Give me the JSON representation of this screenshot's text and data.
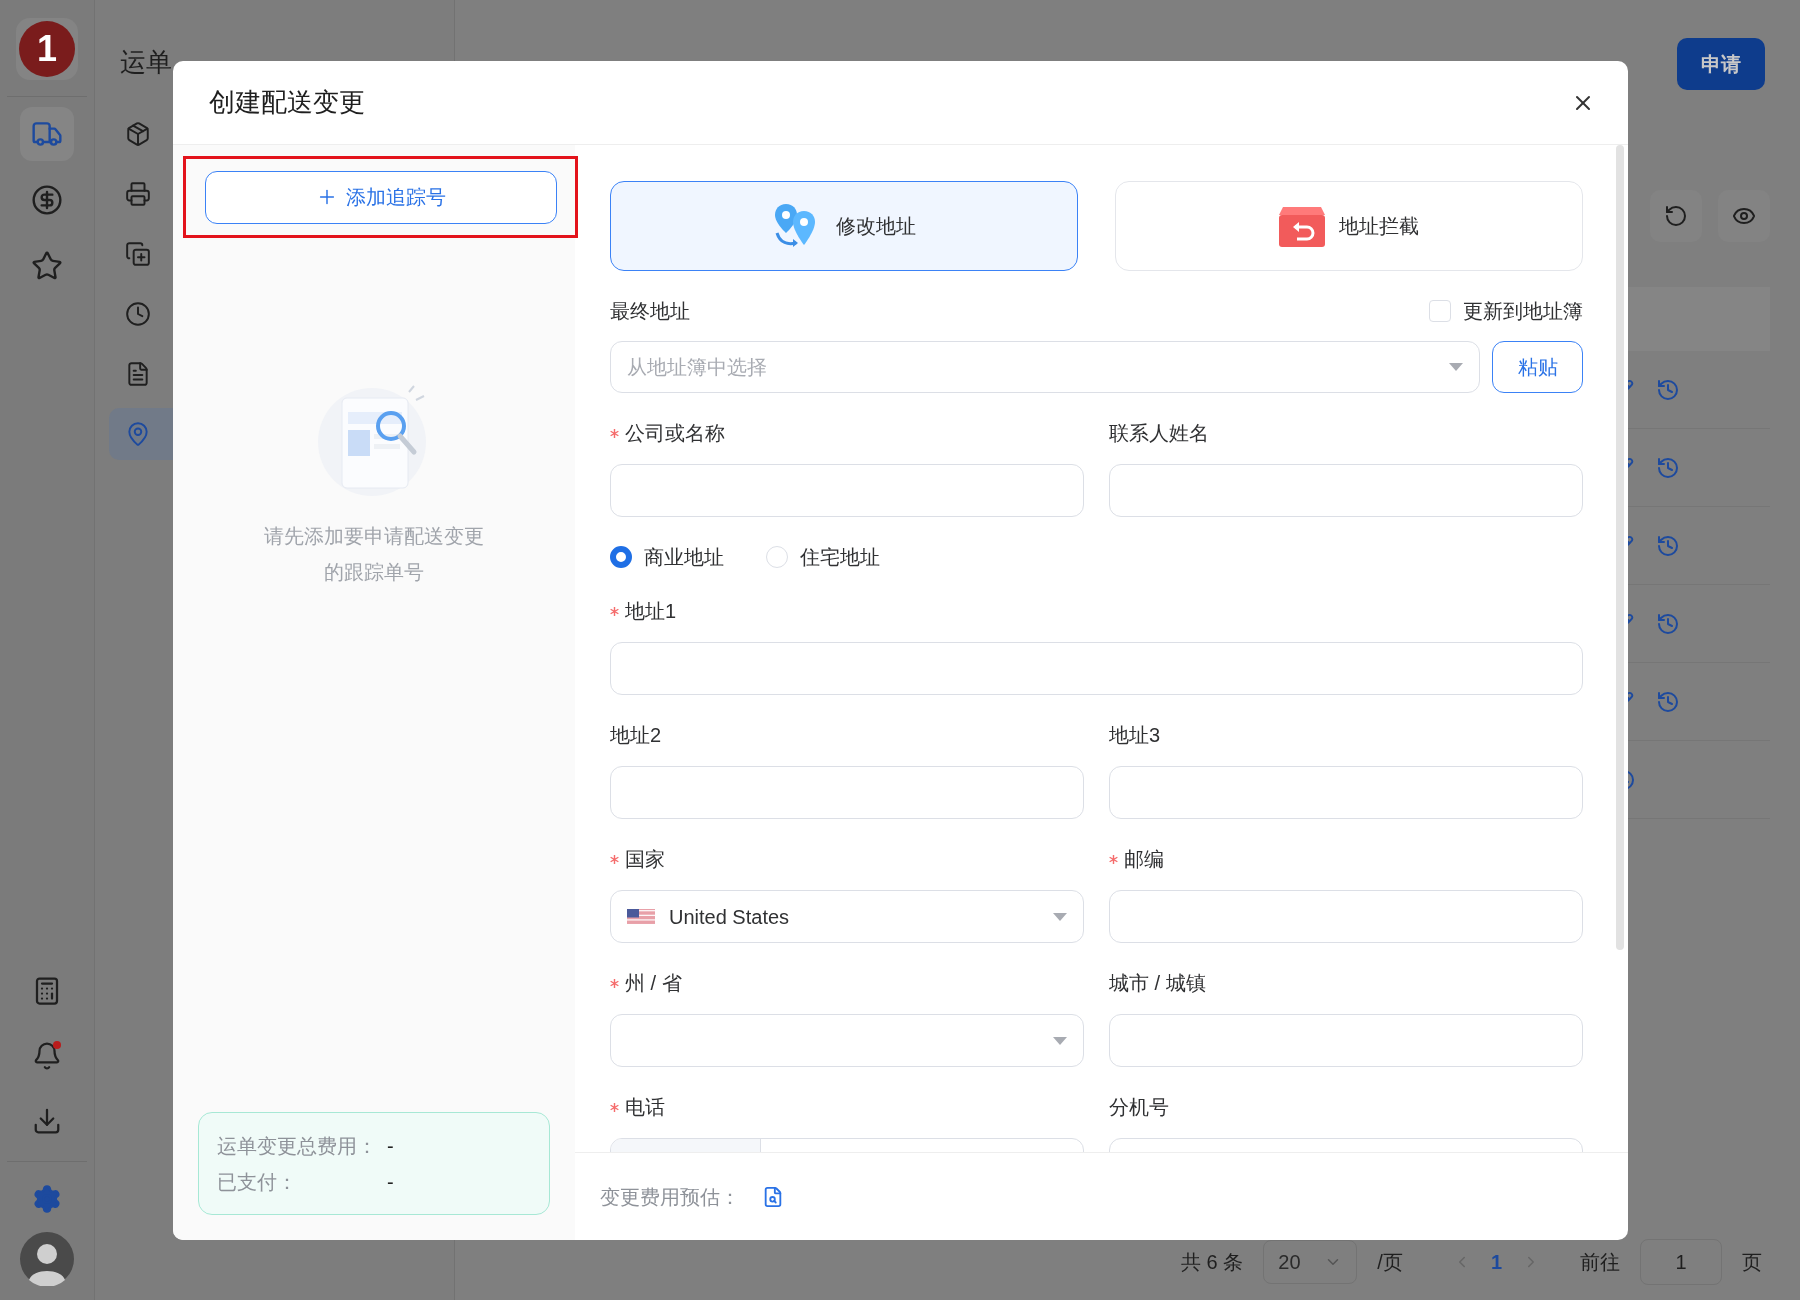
{
  "rail": {
    "logo_text": "1",
    "top_items": [
      {
        "selected": true
      },
      {
        "selected": false
      },
      {
        "selected": false
      }
    ],
    "bell_unread": true
  },
  "nav": {
    "title": "运单",
    "items": [
      {
        "selected": false
      },
      {
        "selected": false
      },
      {
        "selected": false
      },
      {
        "selected": false
      },
      {
        "selected": false
      },
      {
        "selected": true
      }
    ]
  },
  "header": {
    "apply_button": "申请"
  },
  "pagination": {
    "total": "共 6 条",
    "page_size": "20",
    "per_page": "/页",
    "current_page": "1",
    "goto_label": "前往",
    "goto_value": "1",
    "page_suffix": "页"
  },
  "dialog": {
    "title": "创建配送变更",
    "add_tracking_button": "添加追踪号",
    "empty_hint": "请先添加要申请配送变更的跟踪单号",
    "cost_summary": [
      {
        "label": "运单变更总费用：",
        "value": "-"
      },
      {
        "label": "已支付：",
        "value": "-"
      }
    ],
    "change_types": [
      {
        "label": "修改地址",
        "selected": true
      },
      {
        "label": "地址拦截",
        "selected": false
      }
    ],
    "final_address_label": "最终地址",
    "update_address_book": {
      "label": "更新到地址簿",
      "checked": false
    },
    "address_book_select": {
      "placeholder": "从地址簿中选择"
    },
    "paste_button": "粘贴",
    "form_rows": [
      {
        "kind": "fields",
        "fields": [
          {
            "label": "公司或名称",
            "required": true,
            "kind": "text"
          },
          {
            "label": "联系人姓名",
            "required": false,
            "kind": "text"
          }
        ]
      },
      {
        "kind": "radio",
        "options": [
          {
            "label": "商业地址",
            "selected": true
          },
          {
            "label": "住宅地址",
            "selected": false
          }
        ]
      },
      {
        "kind": "fields",
        "fields": [
          {
            "label": "地址1",
            "required": true,
            "kind": "wide"
          }
        ]
      },
      {
        "kind": "fields",
        "fields": [
          {
            "label": "地址2",
            "required": false,
            "kind": "text"
          },
          {
            "label": "地址3",
            "required": false,
            "kind": "text"
          }
        ]
      },
      {
        "kind": "fields",
        "fields": [
          {
            "label": "国家",
            "required": true,
            "kind": "country",
            "value": "United States"
          },
          {
            "label": "邮编",
            "required": true,
            "kind": "text"
          }
        ]
      },
      {
        "kind": "fields",
        "fields": [
          {
            "label": "州 / 省",
            "required": true,
            "kind": "select"
          },
          {
            "label": "城市 / 城镇",
            "required": false,
            "kind": "text"
          }
        ]
      },
      {
        "kind": "fields",
        "fields": [
          {
            "label": "电话",
            "required": true,
            "kind": "phone"
          },
          {
            "label": "分机号",
            "required": false,
            "kind": "text"
          }
        ]
      }
    ],
    "footer": {
      "estimate_label": "变更费用预估："
    }
  }
}
